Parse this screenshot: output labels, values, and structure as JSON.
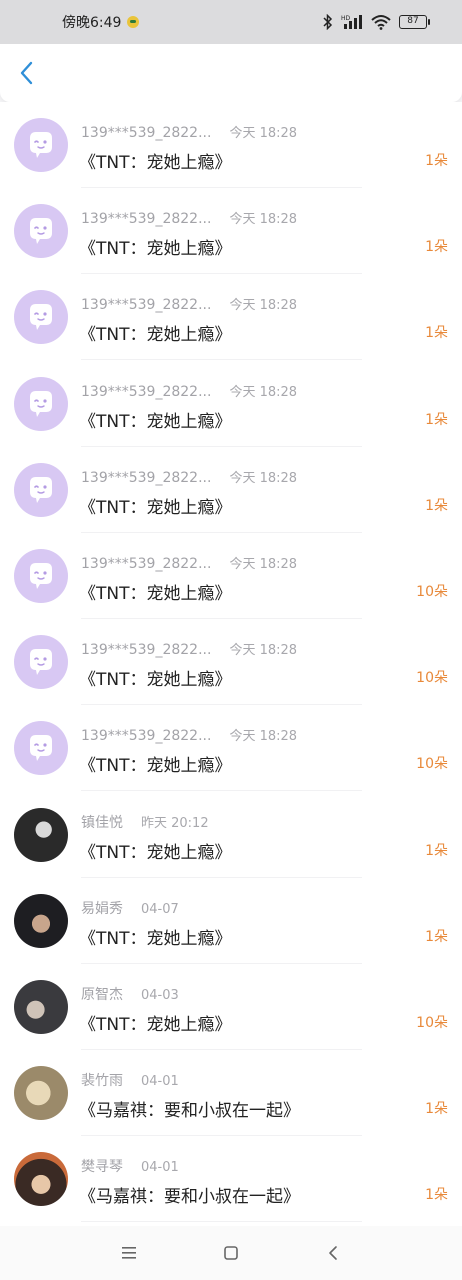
{
  "status": {
    "time": "傍晚6:49",
    "battery": "87"
  },
  "header": {
    "back_icon": "chevron-left-icon"
  },
  "colors": {
    "accent": "#2f8fd8",
    "count": "#e8893a",
    "avatar_default": "#d8c8f3"
  },
  "records": [
    {
      "name": "139***539_2822...",
      "time": "今天 18:28",
      "gift": "《TNT：宠她上瘾》",
      "count": "1朵",
      "avatar": "default"
    },
    {
      "name": "139***539_2822...",
      "time": "今天 18:28",
      "gift": "《TNT：宠她上瘾》",
      "count": "1朵",
      "avatar": "default"
    },
    {
      "name": "139***539_2822...",
      "time": "今天 18:28",
      "gift": "《TNT：宠她上瘾》",
      "count": "1朵",
      "avatar": "default"
    },
    {
      "name": "139***539_2822...",
      "time": "今天 18:28",
      "gift": "《TNT：宠她上瘾》",
      "count": "1朵",
      "avatar": "default"
    },
    {
      "name": "139***539_2822...",
      "time": "今天 18:28",
      "gift": "《TNT：宠她上瘾》",
      "count": "1朵",
      "avatar": "default"
    },
    {
      "name": "139***539_2822...",
      "time": "今天 18:28",
      "gift": "《TNT：宠她上瘾》",
      "count": "10朵",
      "avatar": "default"
    },
    {
      "name": "139***539_2822...",
      "time": "今天 18:28",
      "gift": "《TNT：宠她上瘾》",
      "count": "10朵",
      "avatar": "default"
    },
    {
      "name": "139***539_2822...",
      "time": "今天 18:28",
      "gift": "《TNT：宠她上瘾》",
      "count": "10朵",
      "avatar": "default"
    },
    {
      "name": "镇佳悦",
      "time": "昨天 20:12",
      "gift": "《TNT：宠她上瘾》",
      "count": "1朵",
      "avatar": "photo-1"
    },
    {
      "name": "易娟秀",
      "time": "04-07",
      "gift": "《TNT：宠她上瘾》",
      "count": "1朵",
      "avatar": "photo-2"
    },
    {
      "name": "原智杰",
      "time": "04-03",
      "gift": "《TNT：宠她上瘾》",
      "count": "10朵",
      "avatar": "photo-3"
    },
    {
      "name": "裴竹雨",
      "time": "04-01",
      "gift": "《马嘉祺：要和小叔在一起》",
      "count": "1朵",
      "avatar": "photo-4"
    },
    {
      "name": "樊寻琴",
      "time": "04-01",
      "gift": "《马嘉祺：要和小叔在一起》",
      "count": "1朵",
      "avatar": "photo-5"
    }
  ],
  "nav": {
    "menu_icon": "menu-icon",
    "home_icon": "home-icon",
    "back_icon": "back-icon"
  }
}
